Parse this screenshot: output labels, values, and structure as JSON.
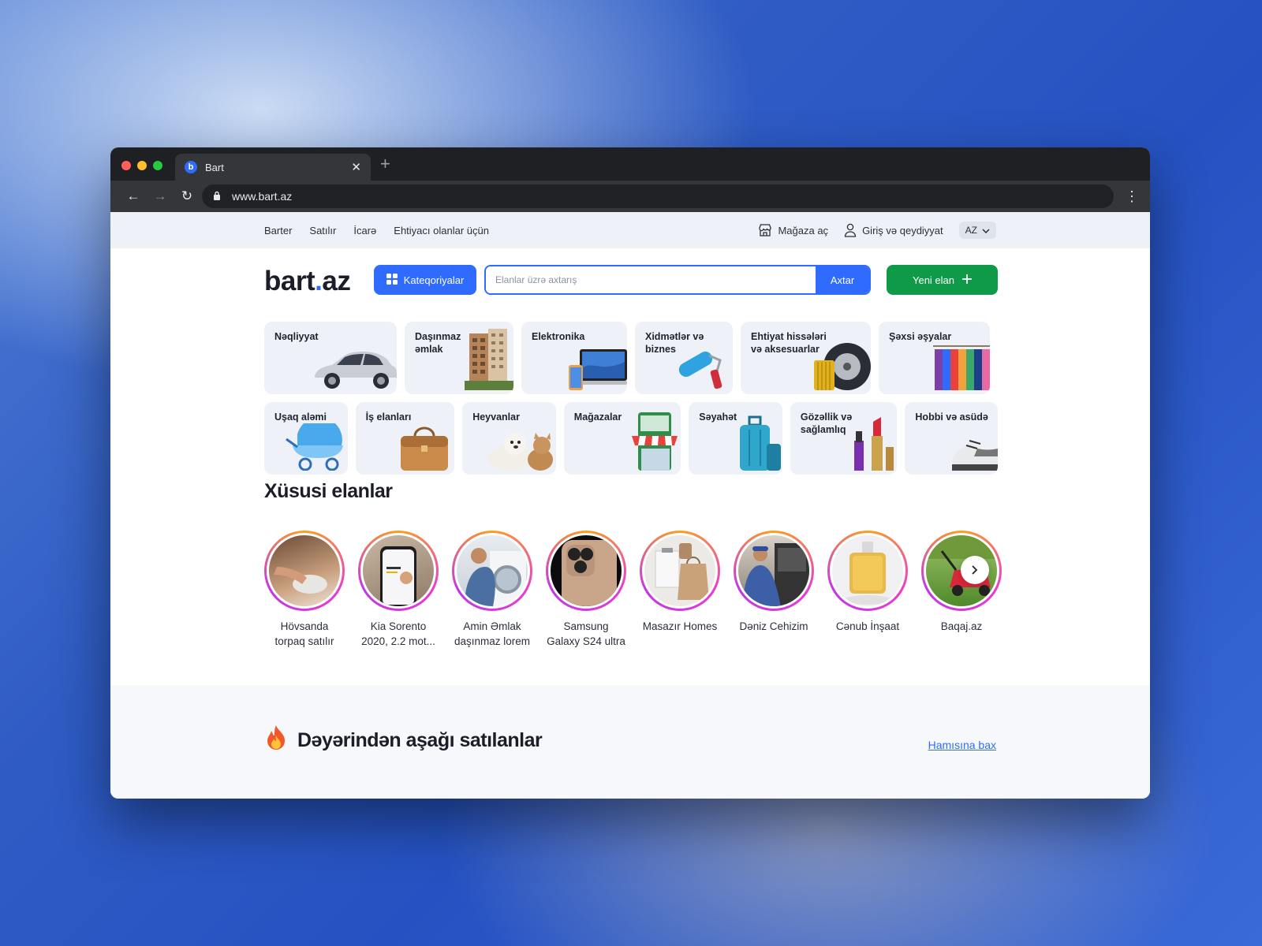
{
  "browser": {
    "tab_title": "Bart",
    "tab_favicon": "b",
    "url": "www.bart.az",
    "traffic_colors": [
      "#ff5f57",
      "#febc2e",
      "#28c840"
    ]
  },
  "topbar": {
    "nav": [
      "Barter",
      "Satılır",
      "İcarə",
      "Ehtiyacı olanlar üçün"
    ],
    "open_store": "Mağaza aç",
    "login": "Giriş və qeydiyyat",
    "lang": "AZ"
  },
  "header": {
    "logo_main": "bart",
    "logo_dot": ".",
    "logo_tld": "az",
    "categories_button": "Kateqoriyalar",
    "search_placeholder": "Elanlar üzrə axtarış",
    "search_button": "Axtar",
    "new_listing_button": "Yeni elan"
  },
  "categories_row1": [
    {
      "label": "Nəqliyyat",
      "icon": "car-icon"
    },
    {
      "label": "Daşınmaz əmlak",
      "icon": "building-icon"
    },
    {
      "label": "Elektronika",
      "icon": "laptop-icon"
    },
    {
      "label": "Xidmətlər və biznes",
      "icon": "paint-roller-icon"
    },
    {
      "label": "Ehtiyat hissələri və aksesuarlar",
      "icon": "tire-icon"
    },
    {
      "label": "Şəxsi əşyalar",
      "icon": "clothes-rack-icon"
    }
  ],
  "categories_row2": [
    {
      "label": "Uşaq aləmi",
      "icon": "stroller-icon"
    },
    {
      "label": "İş elanları",
      "icon": "briefcase-icon"
    },
    {
      "label": "Heyvanlar",
      "icon": "pets-icon"
    },
    {
      "label": "Mağazalar",
      "icon": "store-icon"
    },
    {
      "label": "Səyahət",
      "icon": "suitcase-icon"
    },
    {
      "label": "Gözəllik və sağlamlıq",
      "icon": "cosmetics-icon"
    },
    {
      "label": "Hobbi və asüdə",
      "icon": "sneaker-icon"
    }
  ],
  "featured": {
    "title": "Xüsusi elanlar",
    "items": [
      {
        "name": "Hövsanda torpaq satılır"
      },
      {
        "name": "Kia Sorento 2020, 2.2 mot..."
      },
      {
        "name": "Amin Əmlak daşınmaz lorem"
      },
      {
        "name": "Samsung Galaxy S24 ultra"
      },
      {
        "name": "Masazır Homes"
      },
      {
        "name": "Dəniz Cehizim"
      },
      {
        "name": "Cənub İnşaat"
      },
      {
        "name": "Baqaj.az"
      }
    ]
  },
  "deals": {
    "title": "Dəyərindən aşağı satılanlar",
    "see_all": "Hamısına bax"
  },
  "colors": {
    "primary": "#2f6bff",
    "green": "#0f9a4a"
  }
}
